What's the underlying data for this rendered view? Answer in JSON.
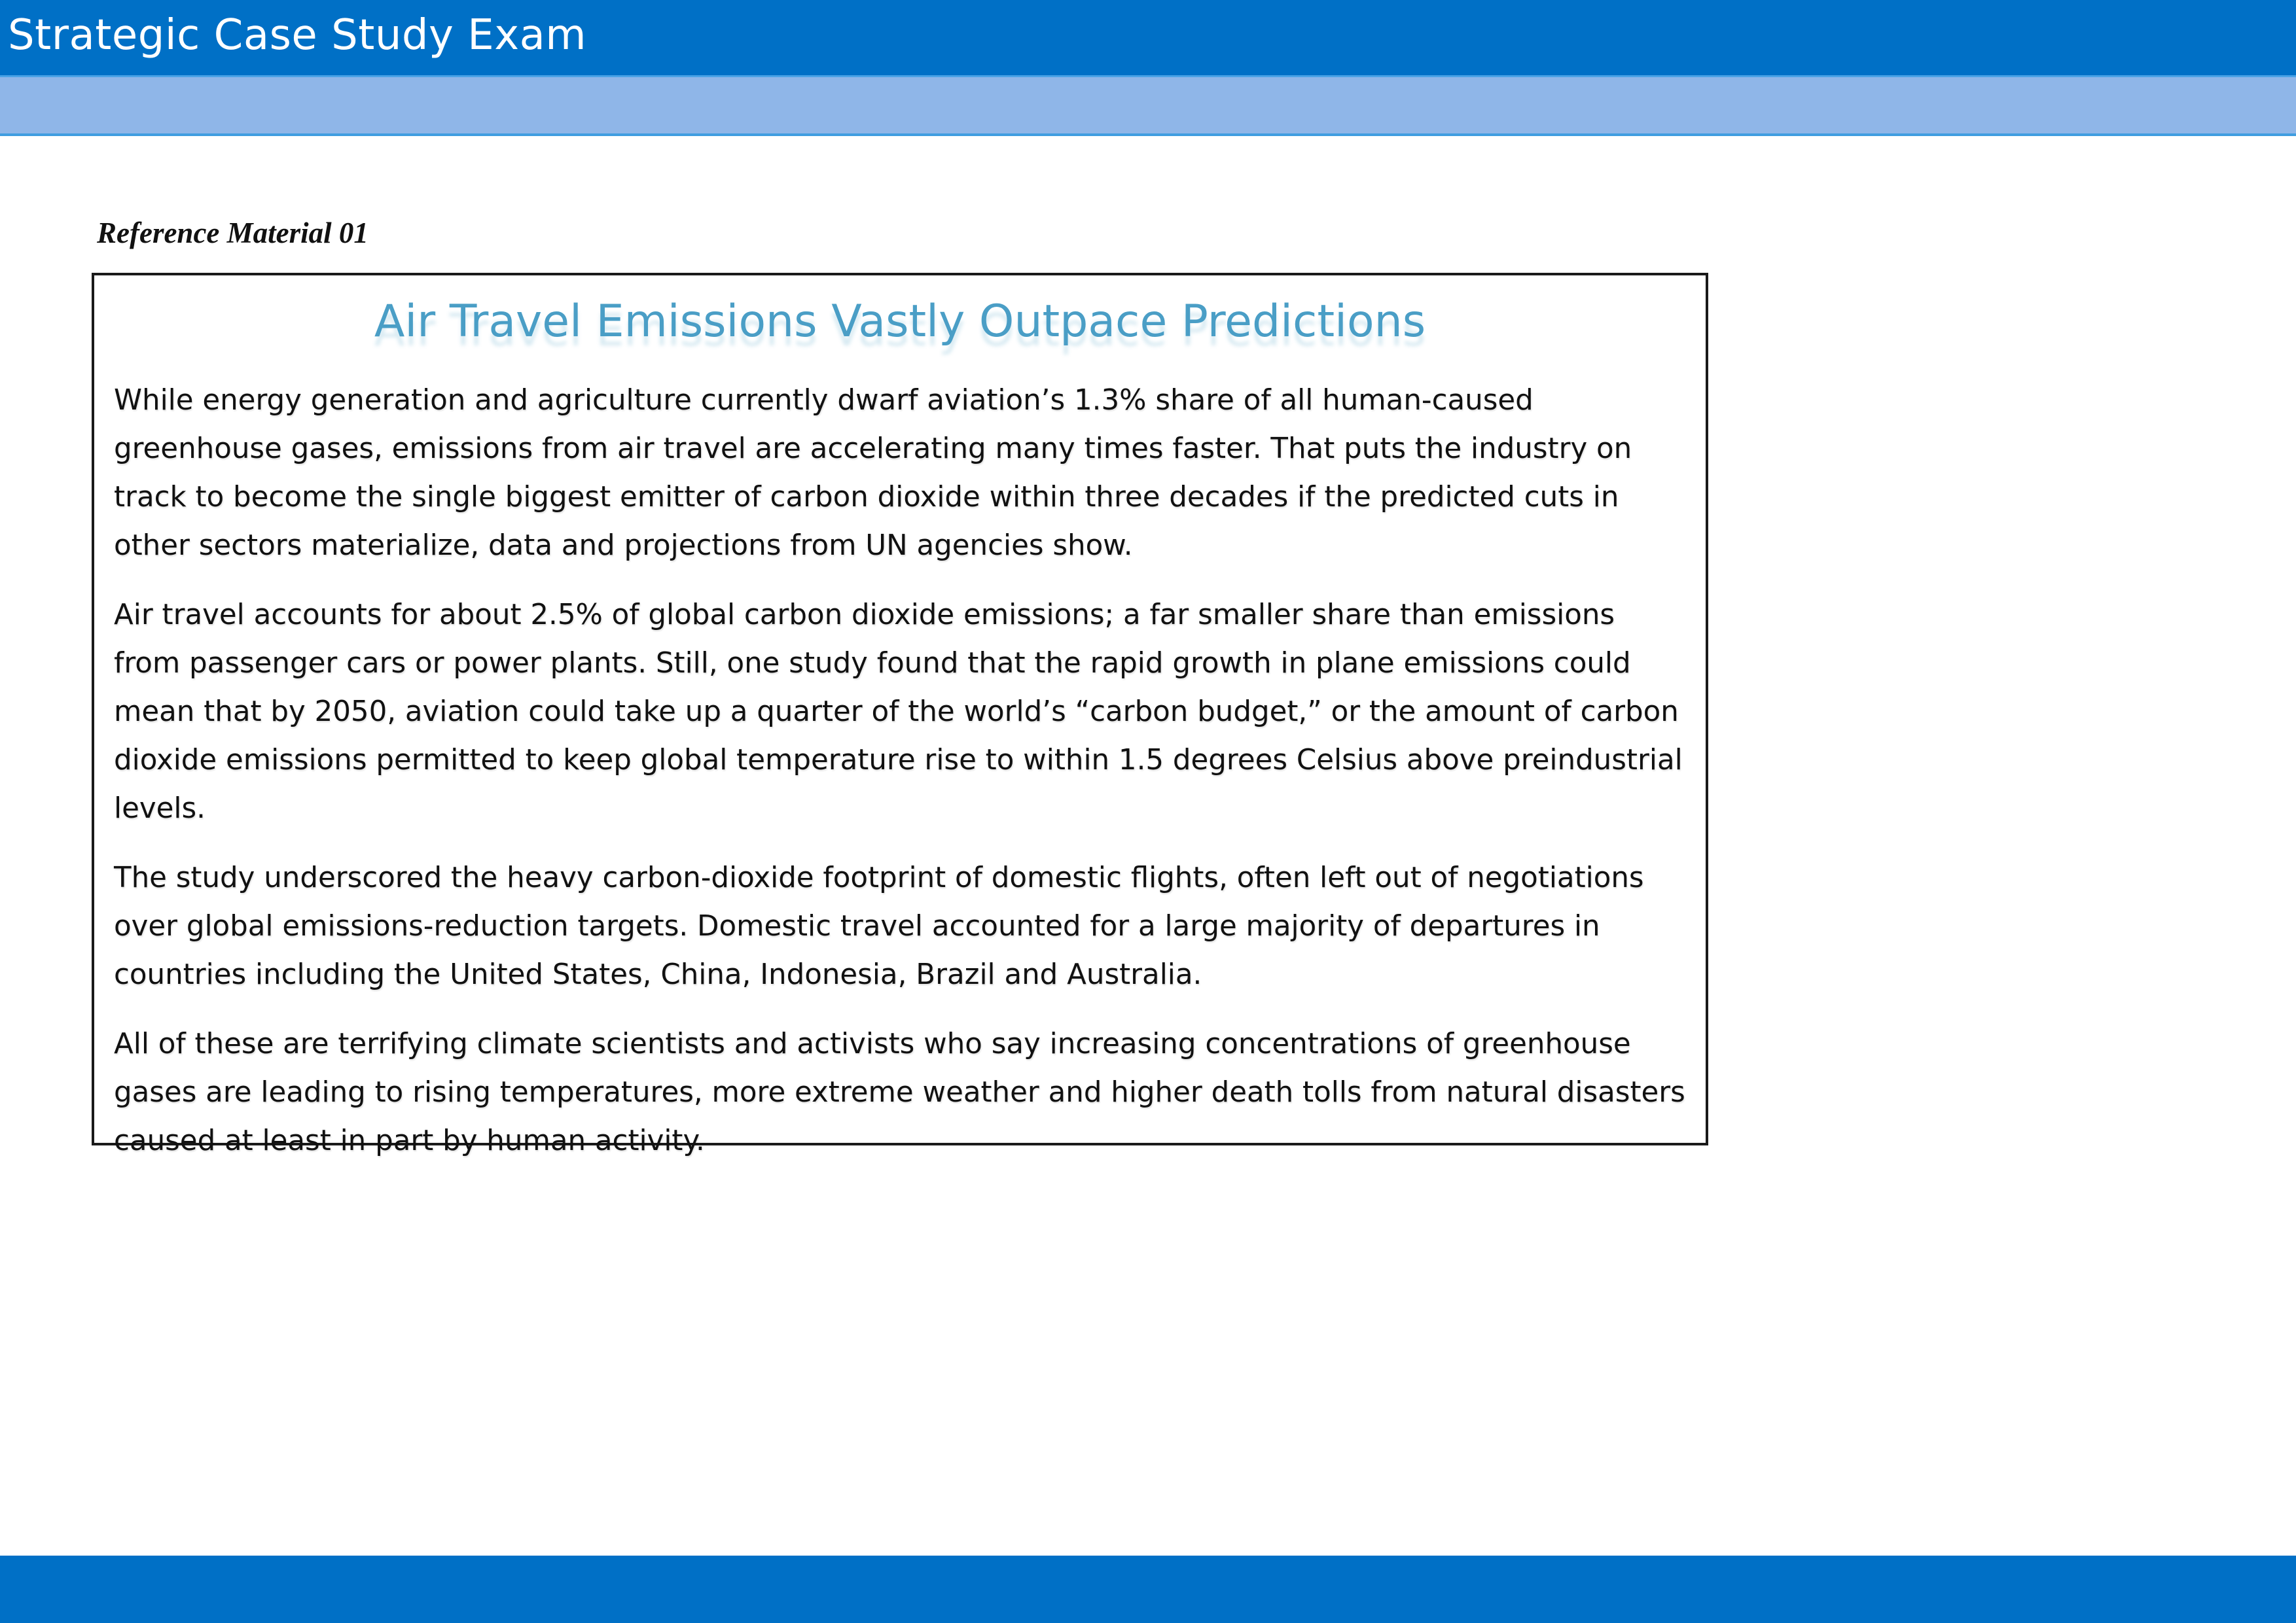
{
  "header": {
    "title": "Strategic Case Study Exam"
  },
  "reference": {
    "label": "Reference Material 01"
  },
  "article": {
    "title": "Air Travel Emissions Vastly Outpace Predictions",
    "paragraphs": [
      "While energy generation and agriculture currently dwarf aviation’s 1.3% share of all human-caused greenhouse gases, emissions from air travel are accelerating many times faster. That puts the industry on track to become the single biggest emitter of carbon dioxide within three decades if the predicted cuts in other sectors materialize, data and projections from UN agencies show.",
      "Air travel accounts for about 2.5% of global carbon dioxide emissions; a far smaller share than emissions from passenger cars or power plants. Still, one study found that the rapid growth in plane emissions could mean that by 2050, aviation could take up a quarter of the world’s “carbon budget,” or the amount of carbon dioxide emissions permitted to keep global temperature rise to within 1.5 degrees Celsius above preindustrial levels.",
      "The study underscored the heavy carbon-dioxide footprint of domestic flights, often left out of negotiations over global emissions-reduction targets. Domestic travel accounted for a large majority of departures in countries including the United States, China, Indonesia, Brazil and Australia.",
      "All of these are terrifying climate scientists and activists who say increasing concentrations of greenhouse gases are leading to rising temperatures, more extreme weather and higher death tolls from natural disasters caused at least in part by human activity."
    ]
  },
  "colors": {
    "header_blue": "#0070c6",
    "subheader_blue": "#8fb6e8",
    "title_blue": "#4a9ec6"
  }
}
